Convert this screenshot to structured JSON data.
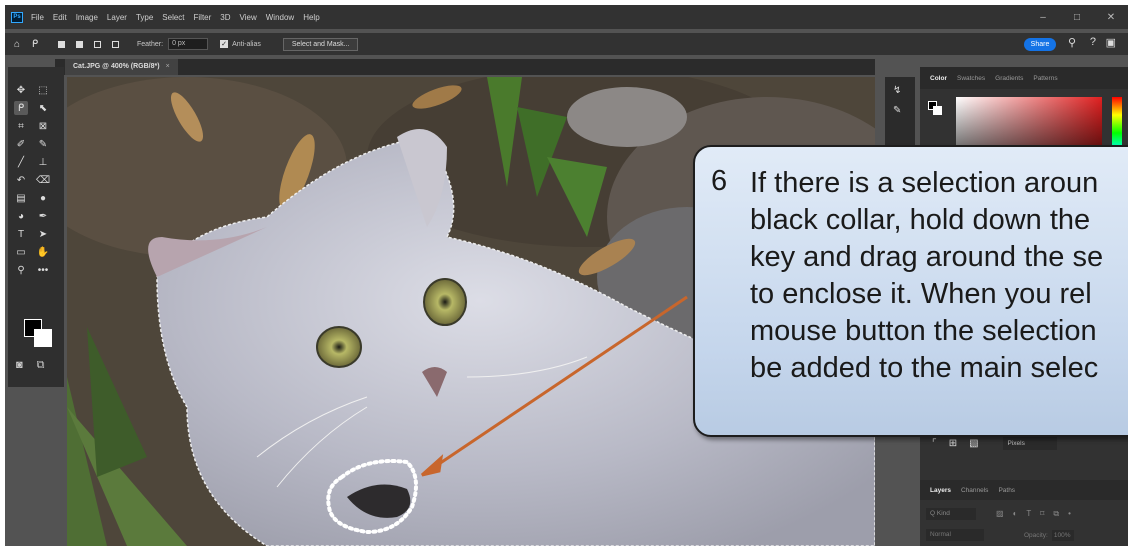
{
  "app": {
    "logo": "Ps",
    "menu": [
      "File",
      "Edit",
      "Image",
      "Layer",
      "Type",
      "Select",
      "Filter",
      "3D",
      "View",
      "Window",
      "Help"
    ],
    "window_controls": [
      "–",
      "□",
      "✕"
    ]
  },
  "options_bar": {
    "feather_label": "Feather:",
    "feather_value": "0 px",
    "antialias_label": "Anti-alias",
    "select_mask_label": "Select and Mask...",
    "share_label": "Share"
  },
  "document": {
    "tab_title": "Cat.JPG @ 400% (RGB/8*)",
    "tab_close": "×"
  },
  "tools": [
    {
      "name": "move-tool",
      "glyph": "✥"
    },
    {
      "name": "marquee-tool",
      "glyph": "⬚"
    },
    {
      "name": "lasso-tool",
      "glyph": "ᑭ",
      "active": true
    },
    {
      "name": "quick-select-tool",
      "glyph": "⬉"
    },
    {
      "name": "crop-tool",
      "glyph": "⌗"
    },
    {
      "name": "frame-tool",
      "glyph": "⊠"
    },
    {
      "name": "eyedropper-tool",
      "glyph": "✐"
    },
    {
      "name": "healing-brush-tool",
      "glyph": "✎"
    },
    {
      "name": "brush-tool",
      "glyph": "╱"
    },
    {
      "name": "stamp-tool",
      "glyph": "⊥"
    },
    {
      "name": "history-brush-tool",
      "glyph": "↶"
    },
    {
      "name": "eraser-tool",
      "glyph": "⌫"
    },
    {
      "name": "gradient-tool",
      "glyph": "▤"
    },
    {
      "name": "blur-tool",
      "glyph": "●"
    },
    {
      "name": "dodge-tool",
      "glyph": "◕"
    },
    {
      "name": "pen-tool",
      "glyph": "✒"
    },
    {
      "name": "type-tool",
      "glyph": "T"
    },
    {
      "name": "path-select-tool",
      "glyph": "➤"
    },
    {
      "name": "shape-tool",
      "glyph": "▭"
    },
    {
      "name": "hand-tool",
      "glyph": "✋"
    },
    {
      "name": "zoom-tool",
      "glyph": "⚲"
    },
    {
      "name": "more-tools",
      "glyph": "•••"
    }
  ],
  "panels": {
    "color_tabs": [
      "Color",
      "Swatches",
      "Gradients",
      "Patterns"
    ],
    "pixels_label": "Pixels",
    "layer_tabs": [
      "Layers",
      "Channels",
      "Paths"
    ],
    "kind_label": "Q Kind",
    "blend_label": "Normal",
    "opacity_label": "Opacity:",
    "opacity_value": "100%"
  },
  "callout": {
    "number": "6",
    "text": "If there is a selection aroun\nblack collar, hold down the\nkey and drag around the se\nto enclose it.  When you rel\nmouse button the selection\nbe added to the main selec"
  },
  "colors": {
    "arrow": "#c8662c",
    "selection_marker": "#ffffff",
    "callout_border": "#1d1d1d"
  }
}
